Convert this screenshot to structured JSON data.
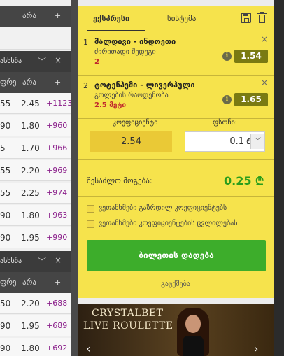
{
  "left_table": {
    "header_top": {
      "col1": "არა",
      "plus": "+"
    },
    "section1": {
      "title": "ასხსნა"
    },
    "header_mid": {
      "col1": "ფრე",
      "col2": "არა",
      "plus": "+"
    },
    "rows": [
      {
        "a": "55",
        "b": "2.45",
        "more": "+1123"
      },
      {
        "a": "90",
        "b": "1.80",
        "more": "+960"
      },
      {
        "a": "5",
        "b": "1.70",
        "more": "+966"
      },
      {
        "a": "55",
        "b": "2.20",
        "more": "+969"
      },
      {
        "a": "55",
        "b": "2.25",
        "more": "+974"
      },
      {
        "a": "90",
        "b": "1.80",
        "more": "+963"
      },
      {
        "a": "90",
        "b": "1.95",
        "more": "+990"
      }
    ],
    "section2": {
      "title": "ასხსნა"
    },
    "header_bot": {
      "col1": "ფრე",
      "col2": "არა",
      "plus": "+"
    },
    "rows2": [
      {
        "a": "50",
        "b": "2.20",
        "more": "+688"
      },
      {
        "a": "90",
        "b": "1.95",
        "more": "+689"
      },
      {
        "a": "90",
        "b": "1.80",
        "more": "+692"
      }
    ]
  },
  "slip": {
    "tabs": {
      "single": "ექსპრესი",
      "system": "სისტემა"
    },
    "bets": [
      {
        "num": "1",
        "match": "მალდივი - ინდოეთი",
        "market": "ძირითადი შედეგი",
        "pick": "2",
        "odd": "1.54",
        "info": "i",
        "close": "×"
      },
      {
        "num": "2",
        "match": "ტოტენჰემი - ლივერპული",
        "market": "გოლების რაოდენობა",
        "pick": "2.5 მეტი",
        "odd": "1.65",
        "info": "i",
        "close": "×"
      }
    ],
    "coef_label": "კოეფიციენტი",
    "coef_value": "2.54",
    "money_label": "ფსონი:",
    "stake_value": "0.1",
    "currency": "₾",
    "win_label": "შესაძლო მოგება:",
    "win_value": "0.25 ₾",
    "check1": "ვეთანხმები გაზრდილ კოეფიციენტებს",
    "check2": "ვეთანხმები კოეფიციენტების ცვლილებას",
    "place_button": "ბილეთის დადება",
    "clear_link": "გაუქმება"
  },
  "banner": {
    "line1": "CRYSTALBET",
    "line2": "LIVE ROULETTE",
    "prev": "‹",
    "next": "›"
  },
  "icons": {
    "chevron": "﹀",
    "close": "×",
    "dropdown": "﹀"
  }
}
